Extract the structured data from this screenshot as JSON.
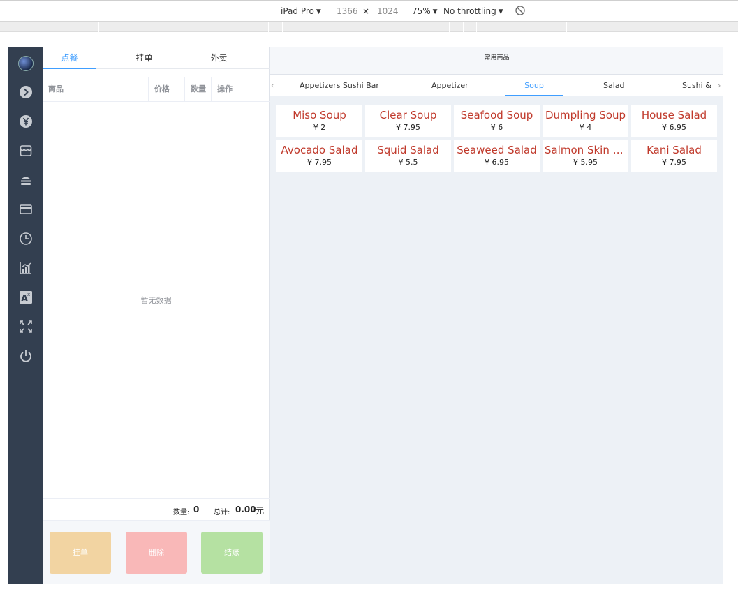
{
  "devtools": {
    "device": "iPad Pro",
    "width": "1366",
    "times": "×",
    "height": "1024",
    "zoom": "75%",
    "throttling": "No throttling"
  },
  "order_panel": {
    "tabs": [
      "点餐",
      "挂单",
      "外卖"
    ],
    "active_tab": "点餐",
    "columns": [
      "商品",
      "价格",
      "数量",
      "操作"
    ],
    "empty_text": "暂无数据",
    "qty_label": "数量:",
    "qty_value": "0",
    "total_label": "总计:",
    "total_value": "0.00",
    "currency_unit": "元",
    "buttons": {
      "hang": "挂单",
      "delete": "删除",
      "checkout": "结账"
    }
  },
  "products": {
    "header": "常用商品",
    "categories": [
      "Appetizers Sushi Bar",
      "Appetizer",
      "Soup",
      "Salad",
      "Sushi & S"
    ],
    "active_category": "Soup",
    "items": [
      {
        "name": "Miso Soup",
        "price": "¥ 2"
      },
      {
        "name": "Clear Soup",
        "price": "¥ 7.95"
      },
      {
        "name": "Seafood Soup",
        "price": "¥ 6"
      },
      {
        "name": "Dumpling Soup",
        "price": "¥ 4"
      },
      {
        "name": "House Salad",
        "price": "¥ 6.95"
      },
      {
        "name": "Avocado Salad",
        "price": "¥ 7.95"
      },
      {
        "name": "Squid Salad",
        "price": "¥ 5.5"
      },
      {
        "name": "Seaweed Salad",
        "price": "¥ 6.95"
      },
      {
        "name": "Salmon Skin S...",
        "price": "¥ 5.95"
      },
      {
        "name": "Kani Salad",
        "price": "¥ 7.95"
      }
    ]
  },
  "sidebar": {
    "icons": [
      "avatar",
      "arrow-right-icon",
      "yen-icon",
      "store-icon",
      "burger-icon",
      "card-icon",
      "clock-icon",
      "chart-icon",
      "translate-icon",
      "fullscreen-icon",
      "power-icon"
    ]
  },
  "colors": {
    "sidebar": "#333f50",
    "accent": "#409eff",
    "product_name": "#c0392b",
    "hang_button": "#f2d4a2",
    "delete_button": "#f9b8b8",
    "checkout_button": "#b5e1a2"
  }
}
